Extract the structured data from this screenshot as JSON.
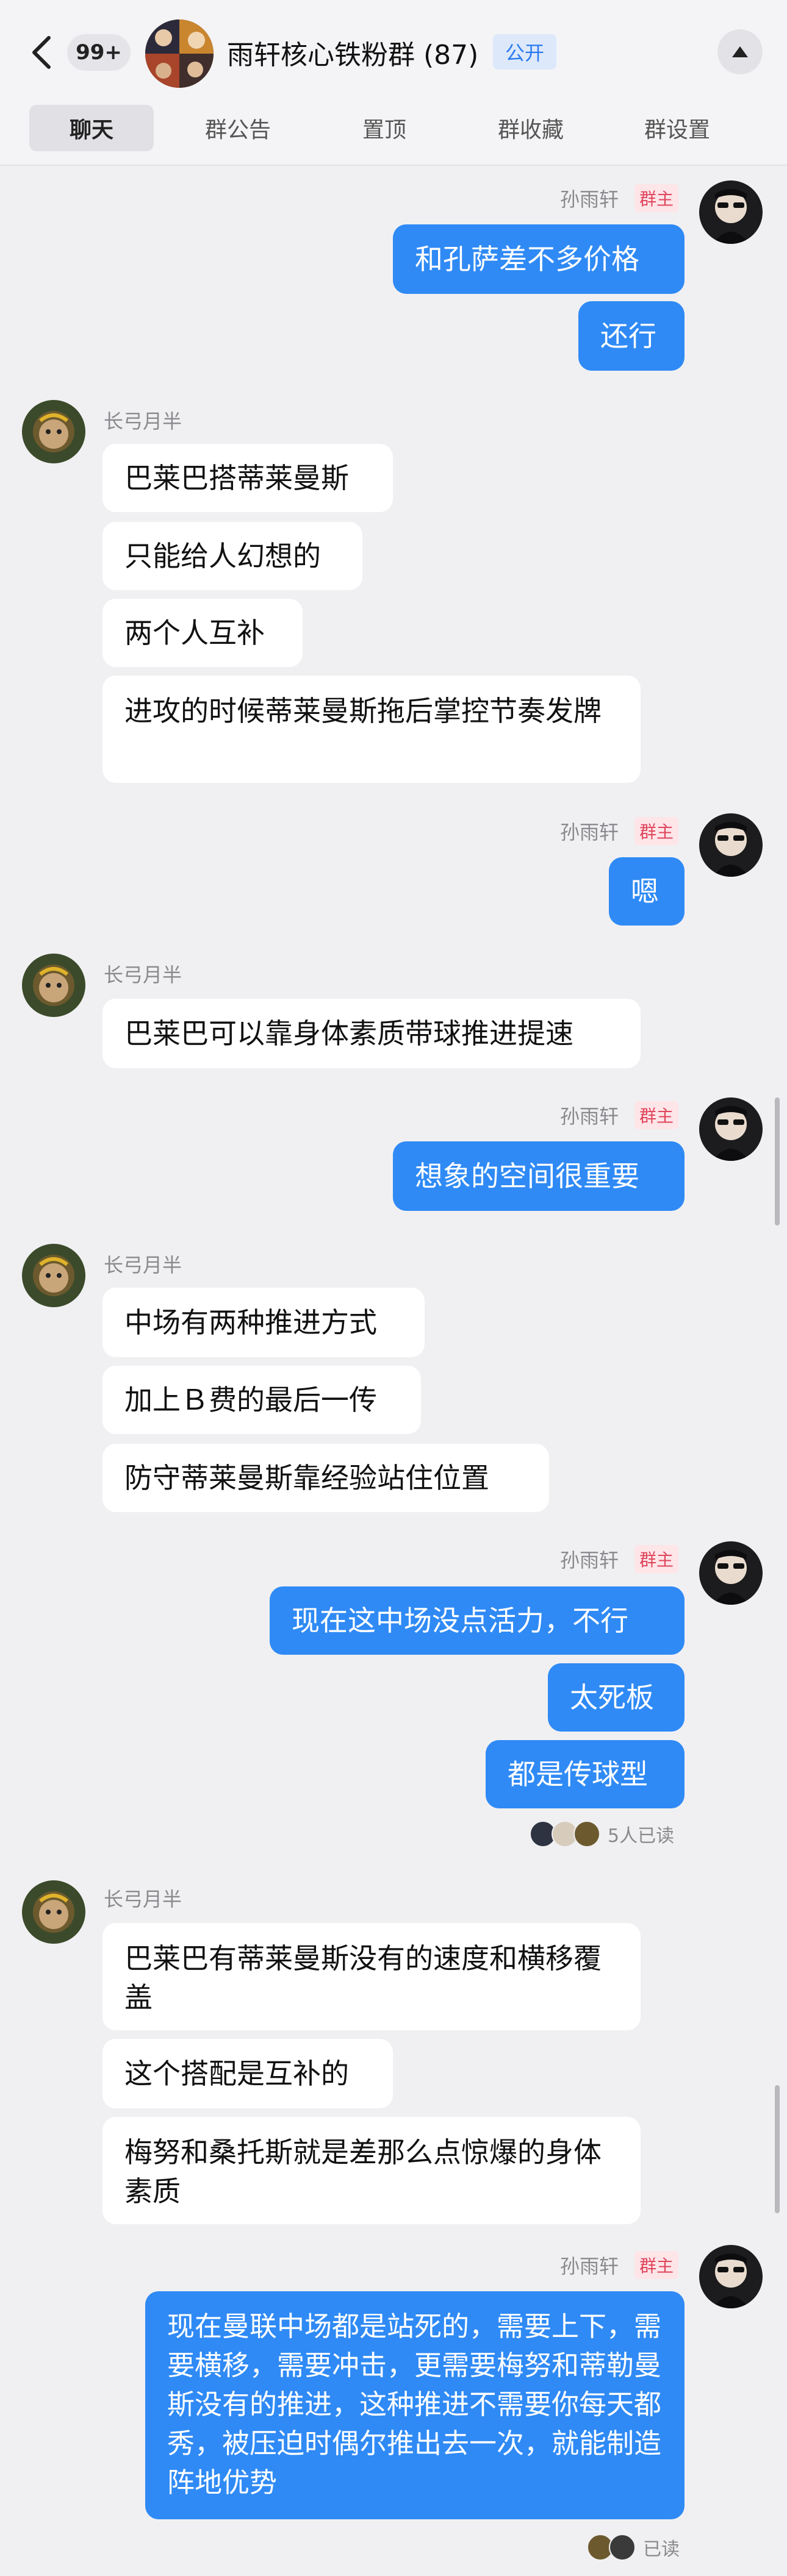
{
  "header": {
    "unread_count": "99+",
    "group_title": "雨轩核心铁粉群 (87)",
    "public_tag": "公开",
    "icons": {
      "back": "chevron-left-icon",
      "collapse": "triangle-up-icon"
    }
  },
  "tabs": [
    {
      "label": "聊天",
      "active": true
    },
    {
      "label": "群公告",
      "active": false
    },
    {
      "label": "置顶",
      "active": false
    },
    {
      "label": "群收藏",
      "active": false
    },
    {
      "label": "群设置",
      "active": false
    }
  ],
  "senders": {
    "owner": {
      "name": "孙雨轩",
      "role_tag": "群主"
    },
    "member": {
      "name": "长弓月半"
    }
  },
  "messages": {
    "m1": "和孔萨差不多价格",
    "m2": "还行",
    "m3": "巴莱巴搭蒂莱曼斯",
    "m4": "只能给人幻想的",
    "m5": "两个人互补",
    "m6": "进攻的时候蒂莱曼斯拖后掌控节奏发牌",
    "m7": "嗯",
    "m8": "巴莱巴可以靠身体素质带球推进提速",
    "m9": "想象的空间很重要",
    "m10": "中场有两种推进方式",
    "m11": "加上Ｂ费的最后一传",
    "m12": "防守蒂莱曼斯靠经验站住位置",
    "m13": "现在这中场没点活力，不行",
    "m14": "太死板",
    "m15": "都是传球型",
    "m16": "巴莱巴有蒂莱曼斯没有的速度和横移覆盖",
    "m17": "这个搭配是互补的",
    "m18": "梅努和桑托斯就是差那么点惊爆的身体素质",
    "m19": "现在曼联中场都是站死的，需要上下，需要横移，需要冲击，更需要梅努和蒂勒曼斯没有的推进，这种推进不需要你每天都秀，被压迫时偶尔推出去一次，就能制造阵地优势"
  },
  "read_receipts": {
    "r1": "5人已读",
    "r2": "已读"
  },
  "colors": {
    "my_bubble": "#2f8af5",
    "their_bubble": "#ffffff",
    "owner_tag_bg": "#fde5e8",
    "owner_tag_text": "#e0455c",
    "public_tag_text": "#2b7bf0"
  }
}
